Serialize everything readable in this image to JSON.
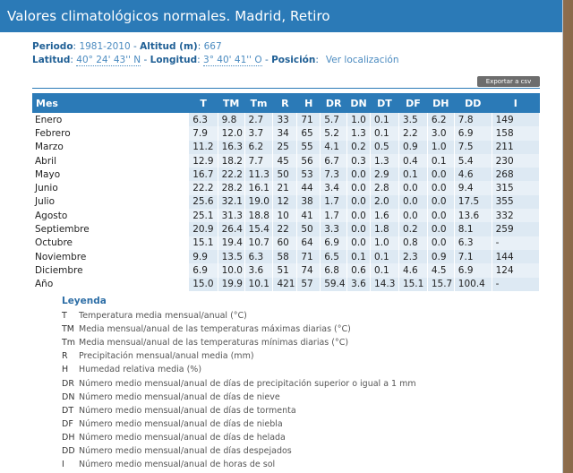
{
  "title": "Valores climatológicos normales. Madrid, Retiro",
  "info": {
    "periodo_label": "Periodo",
    "periodo_value": "1981-2010",
    "altitud_label": "Altitud (m)",
    "altitud_value": "667",
    "latitud_label": "Latitud",
    "latitud_value": "40° 24' 43'' N",
    "longitud_label": "Longitud",
    "longitud_value": "3° 40' 41'' O",
    "posicion_label": "Posición",
    "posicion_link": "Ver localización"
  },
  "export_label": "Exportar a csv",
  "table": {
    "headers": [
      "Mes",
      "T",
      "TM",
      "Tm",
      "R",
      "H",
      "DR",
      "DN",
      "DT",
      "DF",
      "DH",
      "DD",
      "I"
    ],
    "rows": [
      [
        "Enero",
        "6.3",
        "9.8",
        "2.7",
        "33",
        "71",
        "5.7",
        "1.0",
        "0.1",
        "3.5",
        "6.2",
        "7.8",
        "149"
      ],
      [
        "Febrero",
        "7.9",
        "12.0",
        "3.7",
        "34",
        "65",
        "5.2",
        "1.3",
        "0.1",
        "2.2",
        "3.0",
        "6.9",
        "158"
      ],
      [
        "Marzo",
        "11.2",
        "16.3",
        "6.2",
        "25",
        "55",
        "4.1",
        "0.2",
        "0.5",
        "0.9",
        "1.0",
        "7.5",
        "211"
      ],
      [
        "Abril",
        "12.9",
        "18.2",
        "7.7",
        "45",
        "56",
        "6.7",
        "0.3",
        "1.3",
        "0.4",
        "0.1",
        "5.4",
        "230"
      ],
      [
        "Mayo",
        "16.7",
        "22.2",
        "11.3",
        "50",
        "53",
        "7.3",
        "0.0",
        "2.9",
        "0.1",
        "0.0",
        "4.6",
        "268"
      ],
      [
        "Junio",
        "22.2",
        "28.2",
        "16.1",
        "21",
        "44",
        "3.4",
        "0.0",
        "2.8",
        "0.0",
        "0.0",
        "9.4",
        "315"
      ],
      [
        "Julio",
        "25.6",
        "32.1",
        "19.0",
        "12",
        "38",
        "1.7",
        "0.0",
        "2.0",
        "0.0",
        "0.0",
        "17.5",
        "355"
      ],
      [
        "Agosto",
        "25.1",
        "31.3",
        "18.8",
        "10",
        "41",
        "1.7",
        "0.0",
        "1.6",
        "0.0",
        "0.0",
        "13.6",
        "332"
      ],
      [
        "Septiembre",
        "20.9",
        "26.4",
        "15.4",
        "22",
        "50",
        "3.3",
        "0.0",
        "1.8",
        "0.2",
        "0.0",
        "8.1",
        "259"
      ],
      [
        "Octubre",
        "15.1",
        "19.4",
        "10.7",
        "60",
        "64",
        "6.9",
        "0.0",
        "1.0",
        "0.8",
        "0.0",
        "6.3",
        "-"
      ],
      [
        "Noviembre",
        "9.9",
        "13.5",
        "6.3",
        "58",
        "71",
        "6.5",
        "0.1",
        "0.1",
        "2.3",
        "0.9",
        "7.1",
        "144"
      ],
      [
        "Diciembre",
        "6.9",
        "10.0",
        "3.6",
        "51",
        "74",
        "6.8",
        "0.6",
        "0.1",
        "4.6",
        "4.5",
        "6.9",
        "124"
      ],
      [
        "Año",
        "15.0",
        "19.9",
        "10.1",
        "421",
        "57",
        "59.4",
        "3.6",
        "14.3",
        "15.1",
        "15.7",
        "100.4",
        "-"
      ]
    ]
  },
  "legend": {
    "title": "Leyenda",
    "items": [
      {
        "code": "T",
        "desc": "Temperatura media mensual/anual (°C)"
      },
      {
        "code": "TM",
        "desc": "Media mensual/anual de las temperaturas máximas diarias (°C)"
      },
      {
        "code": "Tm",
        "desc": "Media mensual/anual de las temperaturas mínimas diarias (°C)"
      },
      {
        "code": "R",
        "desc": "Precipitación mensual/anual media (mm)"
      },
      {
        "code": "H",
        "desc": "Humedad relativa media (%)"
      },
      {
        "code": "DR",
        "desc": "Número medio mensual/anual de días de precipitación superior o igual a 1 mm"
      },
      {
        "code": "DN",
        "desc": "Número medio mensual/anual de días de nieve"
      },
      {
        "code": "DT",
        "desc": "Número medio mensual/anual de días de tormenta"
      },
      {
        "code": "DF",
        "desc": "Número medio mensual/anual de días de niebla"
      },
      {
        "code": "DH",
        "desc": "Número medio mensual/anual de días de helada"
      },
      {
        "code": "DD",
        "desc": "Número medio mensual/anual de días despejados"
      },
      {
        "code": "I",
        "desc": "Número medio mensual/anual de horas de sol"
      }
    ]
  }
}
